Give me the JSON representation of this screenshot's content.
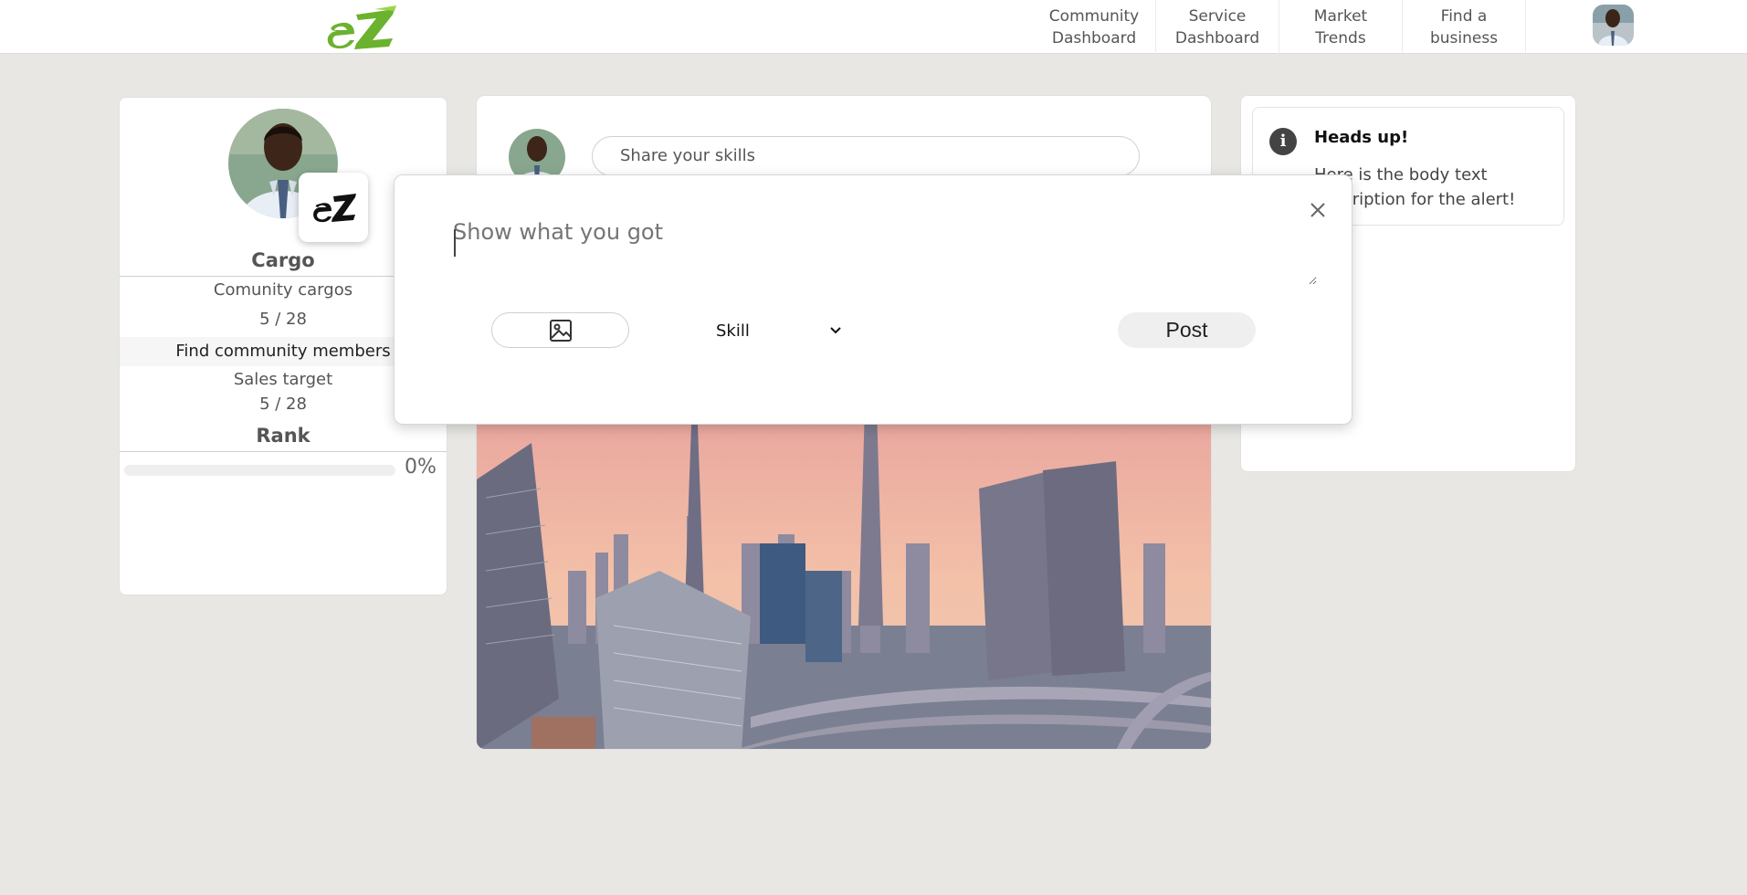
{
  "nav": {
    "items": [
      {
        "line1": "Community",
        "line2": "Dashboard"
      },
      {
        "line1": "Service",
        "line2": "Dashboard"
      },
      {
        "line1": "Market",
        "line2": "Trends"
      },
      {
        "line1": "Find a",
        "line2": "business"
      }
    ],
    "logo_icon": "ez-logo",
    "avatar_icon": "user-avatar"
  },
  "profile": {
    "title": "Cargo",
    "community_label": "Comunity cargos",
    "community_value": "5 / 28",
    "find_members": "Find community members",
    "sales_label": "Sales target",
    "sales_value": "5 / 28",
    "rank_label": "Rank",
    "progress_percent": 0,
    "progress_text": "0%",
    "badge_icon": "ez-company-logo"
  },
  "composer": {
    "share_placeholder": "Share your skills"
  },
  "modal": {
    "textarea_placeholder": "Show what you got",
    "skill_selected": "Skill",
    "post_label": "Post",
    "image_icon": "image-icon",
    "close_icon": "close-icon"
  },
  "alert": {
    "title": "Heads up!",
    "body": "Here is the body text description for the alert!",
    "icon": "info-icon"
  },
  "colors": {
    "background": "#e8e7e3",
    "brand_green": "#7cc242"
  }
}
